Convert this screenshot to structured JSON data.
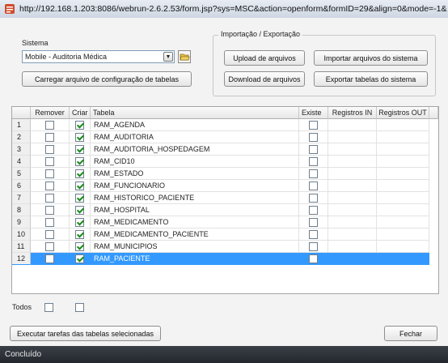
{
  "browser": {
    "url": "http://192.168.1.203:8086/webrun-2.6.2.53/form.jsp?sys=MSC&action=openform&formID=29&align=0&mode=-1&"
  },
  "sistema": {
    "label": "Sistema",
    "selected": "Mobile - Auditoria Médica",
    "load_button": "Carregar arquivo de configuração de tabelas"
  },
  "import_export": {
    "legend": "Importação / Exportação",
    "upload": "Upload de arquivos",
    "import": "Importar arquivos do sistema",
    "download": "Download de arquivos",
    "export": "Exportar tabelas do sistema"
  },
  "grid": {
    "columns": {
      "remover": "Remover",
      "criar": "Criar",
      "tabela": "Tabela",
      "existe": "Existe",
      "in": "Registros IN",
      "out": "Registros OUT"
    },
    "rows": [
      {
        "n": "1",
        "tabela": "RAM_AGENDA",
        "criar": true
      },
      {
        "n": "2",
        "tabela": "RAM_AUDITORIA",
        "criar": true
      },
      {
        "n": "3",
        "tabela": "RAM_AUDITORIA_HOSPEDAGEM",
        "criar": true
      },
      {
        "n": "4",
        "tabela": "RAM_CID10",
        "criar": true
      },
      {
        "n": "5",
        "tabela": "RAM_ESTADO",
        "criar": true
      },
      {
        "n": "6",
        "tabela": "RAM_FUNCIONARIO",
        "criar": true
      },
      {
        "n": "7",
        "tabela": "RAM_HISTORICO_PACIENTE",
        "criar": true
      },
      {
        "n": "8",
        "tabela": "RAM_HOSPITAL",
        "criar": true
      },
      {
        "n": "9",
        "tabela": "RAM_MEDICAMENTO",
        "criar": true
      },
      {
        "n": "10",
        "tabela": "RAM_MEDICAMENTO_PACIENTE",
        "criar": true
      },
      {
        "n": "11",
        "tabela": "RAM_MUNICIPIOS",
        "criar": true
      },
      {
        "n": "12",
        "tabela": "RAM_PACIENTE",
        "criar": true,
        "selected": true
      }
    ]
  },
  "footer": {
    "todos": "Todos",
    "execute": "Executar tarefas das tabelas selecionadas",
    "close": "Fechar"
  },
  "status": {
    "text": "Concluído"
  }
}
